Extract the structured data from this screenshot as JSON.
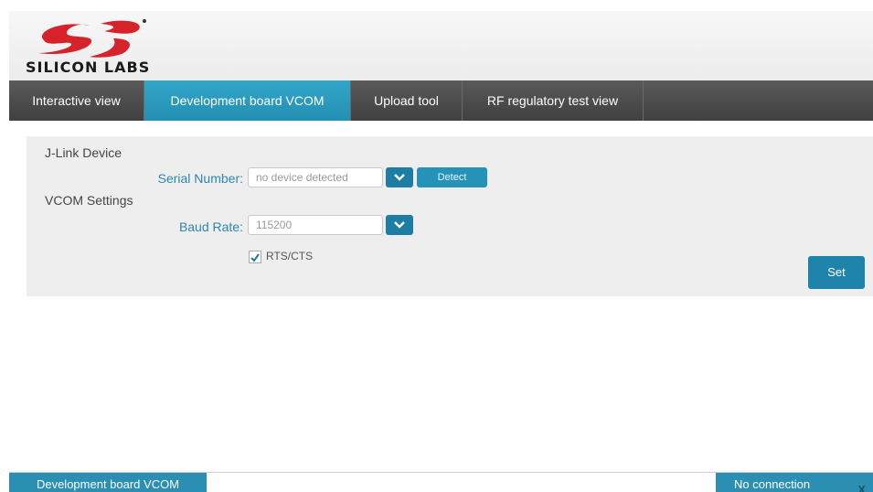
{
  "header": {
    "logo_text": "SILICON LABS"
  },
  "tabs": [
    {
      "label": "Interactive view",
      "active": false
    },
    {
      "label": "Development board VCOM",
      "active": true
    },
    {
      "label": "Upload tool",
      "active": false
    },
    {
      "label": "RF regulatory test view",
      "active": false
    }
  ],
  "panel": {
    "jlink_heading": "J-Link Device",
    "vcom_heading": "VCOM Settings",
    "serial_label": "Serial Number:",
    "serial_value": "no device detected",
    "detect_label": "Detect",
    "baud_label": "Baud Rate:",
    "baud_value": "115200",
    "rts_label": "RTS/CTS",
    "rts_checked": true,
    "set_label": "Set"
  },
  "status": {
    "left": "Development board VCOM",
    "right": "No connection",
    "close": "X"
  },
  "colors": {
    "accent": "#2593b7",
    "nav_bg": "#4a4a4a",
    "logo_red": "#d6222a"
  }
}
